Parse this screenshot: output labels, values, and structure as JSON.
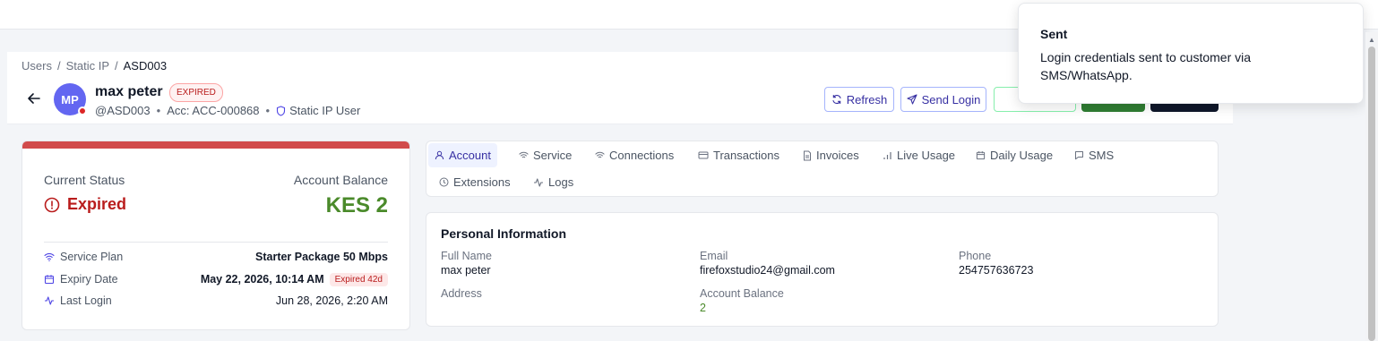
{
  "breadcrumb": {
    "items": [
      "Users",
      "Static IP"
    ],
    "separator": "/",
    "current": "ASD003"
  },
  "user": {
    "initials": "MP",
    "name": "max peter",
    "status_badge": "EXPIRED",
    "username": "@ASD003",
    "account": "Acc: ACC-000868",
    "role": "Static IP User",
    "meta_separator": "•"
  },
  "actions": {
    "refresh": "Refresh",
    "send_login": "Send Login"
  },
  "status_card": {
    "current_status_label": "Current Status",
    "current_status_value": "Expired",
    "balance_label": "Account Balance",
    "balance_value": "KES 2",
    "service_plan_label": "Service Plan",
    "service_plan_value": "Starter Package 50 Mbps",
    "expiry_label": "Expiry Date",
    "expiry_value": "May 22, 2026, 10:14 AM",
    "expiry_chip": "Expired 42d",
    "last_login_label": "Last Login",
    "last_login_value": "Jun 28, 2026, 2:20 AM"
  },
  "tabs": [
    {
      "label": "Account",
      "icon": "user-icon"
    },
    {
      "label": "Service",
      "icon": "wifi-icon"
    },
    {
      "label": "Connections",
      "icon": "wifi-icon"
    },
    {
      "label": "Transactions",
      "icon": "card-icon"
    },
    {
      "label": "Invoices",
      "icon": "document-icon"
    },
    {
      "label": "Live Usage",
      "icon": "bars-icon"
    },
    {
      "label": "Daily Usage",
      "icon": "calendar-icon"
    },
    {
      "label": "SMS",
      "icon": "message-icon"
    },
    {
      "label": "Extensions",
      "icon": "clock-icon"
    },
    {
      "label": "Logs",
      "icon": "activity-icon"
    }
  ],
  "personal_info": {
    "title": "Personal Information",
    "full_name_label": "Full Name",
    "full_name": "max peter",
    "email_label": "Email",
    "email": "firefoxstudio24@gmail.com",
    "phone_label": "Phone",
    "phone": "254757636723",
    "address_label": "Address",
    "balance_label": "Account Balance",
    "balance": "2"
  },
  "toast": {
    "title": "Sent",
    "message": "Login credentials sent to customer via SMS/WhatsApp."
  },
  "colors": {
    "accent": "#3730a3",
    "expired_red": "#b91c1c",
    "balance_green": "#4a8a2a",
    "avatar": "#6366f1"
  }
}
